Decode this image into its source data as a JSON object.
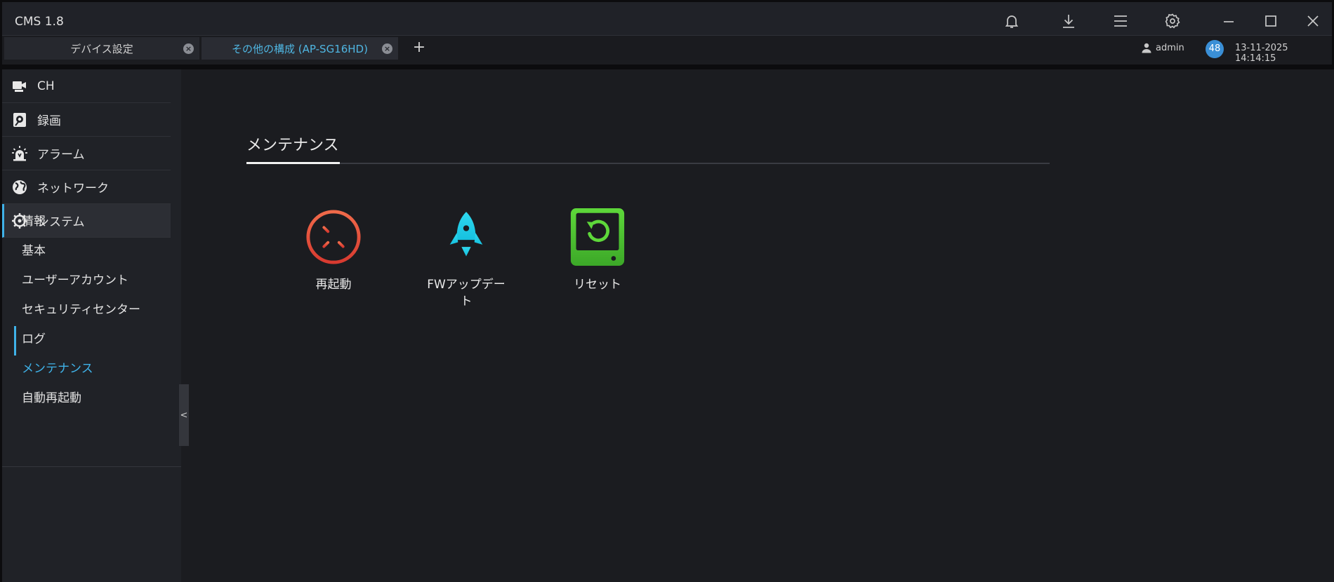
{
  "app": {
    "title": "CMS 1.8"
  },
  "window_controls": [
    "bell-icon",
    "download-icon",
    "menu-icon",
    "gear-icon",
    "minimize-icon",
    "maximize-icon",
    "close-icon"
  ],
  "tabs": [
    {
      "label": "デバイス設定"
    },
    {
      "label": "その他の構成 (AP-SG16HD)"
    }
  ],
  "tab_add_label": "+",
  "user": {
    "name": "admin",
    "badge": "48",
    "datetime": "13-11-2025 14:14:15"
  },
  "sidebar": {
    "nav": [
      {
        "label": "CH",
        "icon": "camera-icon"
      },
      {
        "label": "録画",
        "icon": "recording-icon"
      },
      {
        "label": "アラーム",
        "icon": "alarm-icon"
      },
      {
        "label": "ネットワーク",
        "icon": "globe-icon"
      },
      {
        "label": "システム",
        "icon": "gear-icon"
      }
    ],
    "sub": [
      {
        "label": "情報"
      },
      {
        "label": "基本"
      },
      {
        "label": "ユーザーアカウント"
      },
      {
        "label": "セキュリティセンター"
      },
      {
        "label": "ログ"
      },
      {
        "label": "メンテナンス"
      },
      {
        "label": "自動再起動"
      }
    ],
    "collapse_label": "<"
  },
  "main": {
    "title": "メンテナンス",
    "tiles": [
      {
        "label": "再起動",
        "icon": "restart-icon",
        "color": "#e4533e"
      },
      {
        "label": "FWアップデート",
        "icon": "rocket-icon",
        "color": "#22d3ee"
      },
      {
        "label": "リセット",
        "icon": "reset-icon",
        "color": "#4fc934"
      }
    ]
  },
  "colors": {
    "accent": "#3fb2e8",
    "background": "#1b1c20",
    "sidebar": "#202227"
  }
}
